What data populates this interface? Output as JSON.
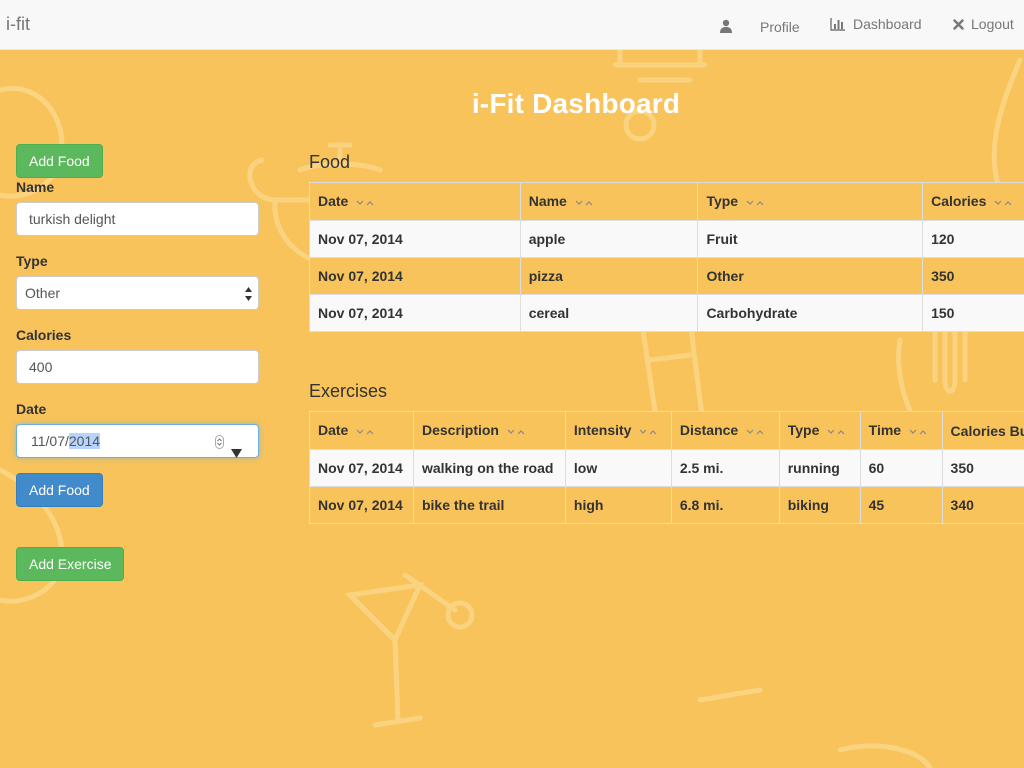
{
  "navbar": {
    "brand": "i-fit",
    "links": [
      {
        "label": "Profile",
        "icon": "user-icon"
      },
      {
        "label": "Dashboard",
        "icon": "bar-chart-icon"
      },
      {
        "label": "Logout",
        "icon": "close-icon"
      }
    ]
  },
  "page": {
    "title": "i-Fit Dashboard"
  },
  "sidebar": {
    "add_food_top": "Add Food",
    "name_label": "Name",
    "name_value": "turkish delight",
    "type_label": "Type",
    "type_value": "Other",
    "calories_label": "Calories",
    "calories_value": "400",
    "date_label": "Date",
    "date_prefix": "11/07/",
    "date_year": "2014",
    "add_food_submit": "Add Food",
    "add_exercise": "Add Exercise"
  },
  "food": {
    "title": "Food",
    "columns": [
      "Date",
      "Name",
      "Type",
      "Calories"
    ],
    "rows": [
      [
        "Nov 07, 2014",
        "apple",
        "Fruit",
        "120"
      ],
      [
        "Nov 07, 2014",
        "pizza",
        "Other",
        "350"
      ],
      [
        "Nov 07, 2014",
        "cereal",
        "Carbohydrate",
        "150"
      ]
    ]
  },
  "exercises": {
    "title": "Exercises",
    "columns": [
      "Date",
      "Description",
      "Intensity",
      "Distance",
      "Type",
      "Time",
      "Calories Bu"
    ],
    "rows": [
      [
        "Nov 07, 2014",
        "walking on the road",
        "low",
        "2.5 mi.",
        "running",
        "60",
        "350"
      ],
      [
        "Nov 07, 2014",
        "bike the trail",
        "high",
        "6.8 mi.",
        "biking",
        "45",
        "340"
      ]
    ]
  },
  "colors": {
    "background": "#f8c35b",
    "success": "#5cb85c",
    "primary": "#428bca",
    "navbar": "#f8f8f8"
  }
}
